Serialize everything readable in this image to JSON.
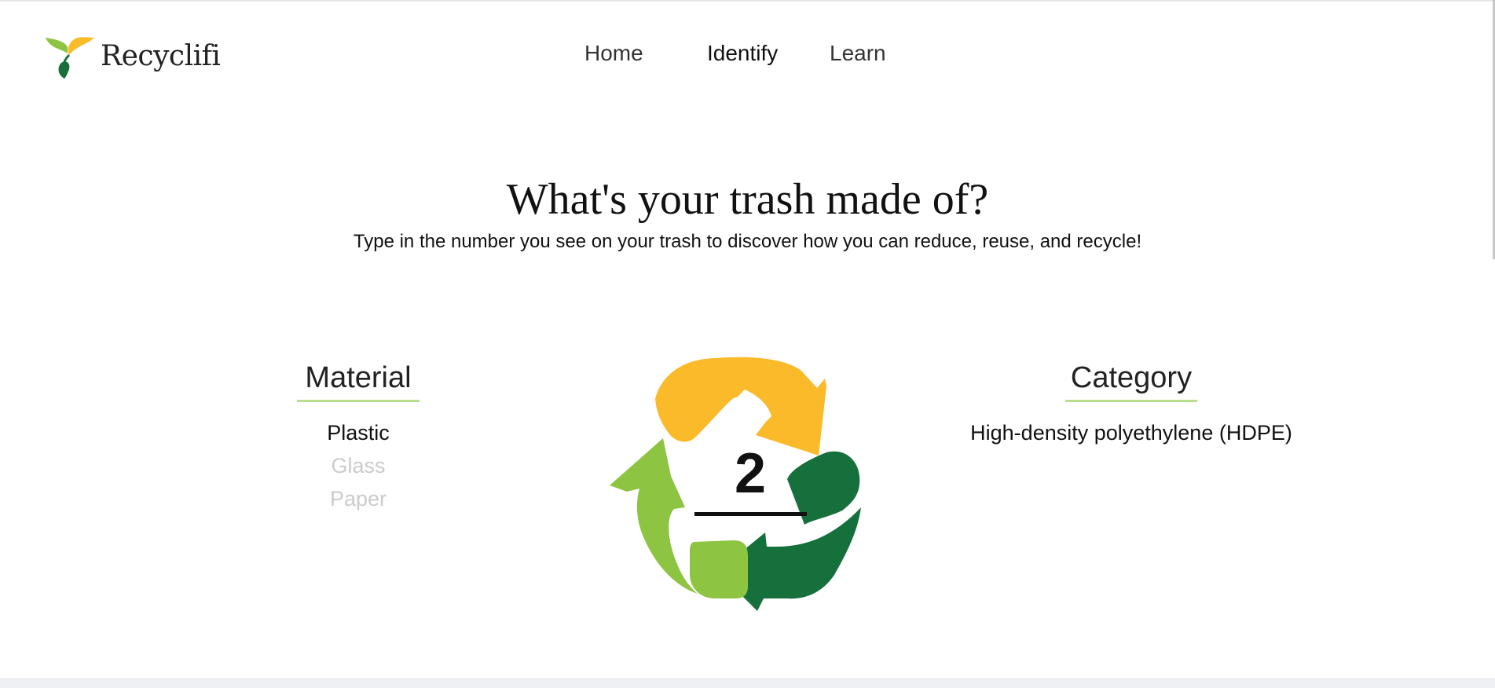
{
  "header": {
    "app_name": "Recyclifi",
    "logo_icon": "sprout-leaf-icon",
    "nav": [
      {
        "label": "Home",
        "active": false
      },
      {
        "label": "Identify",
        "active": true
      },
      {
        "label": "Learn",
        "active": false
      }
    ]
  },
  "main": {
    "title": "What's your trash made of?",
    "subtitle": "Type in the number you see on your trash to discover how you can reduce, reuse, and recycle!",
    "material": {
      "heading": "Material",
      "options": [
        {
          "label": "Plastic",
          "selected": true
        },
        {
          "label": "Glass",
          "selected": false
        },
        {
          "label": "Paper",
          "selected": false
        }
      ]
    },
    "recycle_symbol": {
      "icon": "recycle-arrows-icon",
      "resin_code": "2"
    },
    "category": {
      "heading": "Category",
      "value": "High-density polyethylene (HDPE)"
    }
  },
  "colors": {
    "accent_underline": "#b7df8c",
    "arrow_yellow": "#fbba2a",
    "arrow_light_green": "#8dc441",
    "arrow_dark_green": "#15703c",
    "inactive_text": "#cbcbcb"
  }
}
